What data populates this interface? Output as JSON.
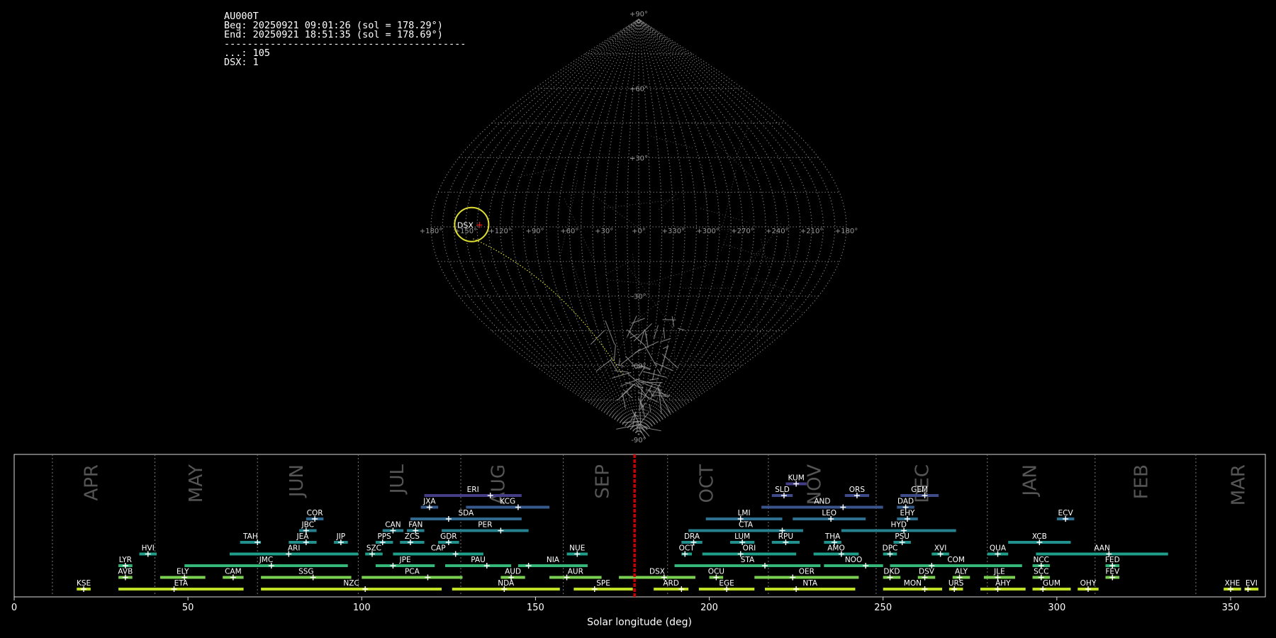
{
  "info": {
    "station": "AU000T",
    "begin": "Beg: 20250921 09:01:26 (sol = 178.29°)",
    "end": "End: 20250921 18:51:35 (sol = 178.69°)",
    "separator": "------------------------------------------",
    "count_unassoc": "...: 105",
    "count_dsx": "DSX: 1"
  },
  "colors": {
    "background": "#000000",
    "grid": "#7f7f7f",
    "radiant_outline": "#dddd33",
    "radiant_marker": "#ff2020",
    "current_sol_line": "#cc0000",
    "month_label": "#555555"
  },
  "chart_data": [
    {
      "type": "scatter",
      "projection": "sinusoidal",
      "grid_dotted": true,
      "lat_ticks": [
        "+90°",
        "+60°",
        "+30°",
        "-30°",
        "-60°",
        "-90°"
      ],
      "lon_ticks": [
        "+180°",
        "+150°",
        "+120°",
        "+90°",
        "+60°",
        "+30°",
        "+0°",
        "+330°",
        "+300°",
        "+270°",
        "+240°",
        "+210°",
        "+180°"
      ],
      "radiants": [
        {
          "label": "DSX",
          "lambda_rel": 146,
          "beta": 1,
          "color": "#dddd33"
        }
      ],
      "dsx_track_end": {
        "lambda_rel": 32,
        "beta": -64
      }
    },
    {
      "type": "timeline",
      "xlabel": "Solar longitude (deg)",
      "xlim": [
        0,
        360
      ],
      "xticks": [
        0,
        50,
        100,
        150,
        200,
        250,
        300,
        350
      ],
      "current_sol": 178.5,
      "months": [
        {
          "name": "APR",
          "start": 11,
          "center": 24
        },
        {
          "name": "MAY",
          "start": 40.5,
          "center": 54
        },
        {
          "name": "JUN",
          "start": 70,
          "center": 83
        },
        {
          "name": "JUL",
          "start": 99,
          "center": 112
        },
        {
          "name": "AUG",
          "start": 128.5,
          "center": 141
        },
        {
          "name": "SEP",
          "start": 158,
          "center": 171
        },
        {
          "name": "OCT",
          "start": 188,
          "center": 201
        },
        {
          "name": "NOV",
          "start": 217,
          "center": 232
        },
        {
          "name": "DEC",
          "start": 248,
          "center": 263
        },
        {
          "name": "JAN",
          "start": 280,
          "center": 294
        },
        {
          "name": "FEB",
          "start": 311,
          "center": 326
        },
        {
          "name": "MAR",
          "start": 340,
          "center": 354
        }
      ],
      "showers": [
        {
          "code": "KUM",
          "start": 222,
          "end": 228,
          "peak": 225,
          "row": 10,
          "color": "#433e85"
        },
        {
          "code": "ERI",
          "start": 118,
          "end": 146,
          "peak": 137,
          "row": 9,
          "color": "#433e85"
        },
        {
          "code": "SLD",
          "start": 218,
          "end": 224,
          "peak": 221.5,
          "row": 9,
          "color": "#3f4a8a"
        },
        {
          "code": "ORS",
          "start": 239,
          "end": 246,
          "peak": 242.5,
          "row": 9,
          "color": "#3f4a8a"
        },
        {
          "code": "GEM",
          "start": 255,
          "end": 266,
          "peak": 262,
          "row": 9,
          "color": "#3e4c8a"
        },
        {
          "code": "JXA",
          "start": 117,
          "end": 122,
          "peak": 119.5,
          "row": 8,
          "color": "#375a8c"
        },
        {
          "code": "KCG",
          "start": 130,
          "end": 154,
          "peak": 145,
          "row": 8,
          "color": "#375a8c"
        },
        {
          "code": "AND",
          "start": 215,
          "end": 250,
          "peak": 238.5,
          "row": 8,
          "color": "#3a548c"
        },
        {
          "code": "DAD",
          "start": 254,
          "end": 259,
          "peak": 256.5,
          "row": 8,
          "color": "#375a8c"
        },
        {
          "code": "COR",
          "start": 84,
          "end": 89,
          "peak": 86.5,
          "row": 7,
          "color": "#31688e"
        },
        {
          "code": "SDA",
          "start": 114,
          "end": 146,
          "peak": 125,
          "row": 7,
          "color": "#31688e"
        },
        {
          "code": "LMI",
          "start": 199,
          "end": 221,
          "peak": 209,
          "row": 7,
          "color": "#2e6e8e"
        },
        {
          "code": "LEO",
          "start": 224,
          "end": 245,
          "peak": 235,
          "row": 7,
          "color": "#2e6e8e"
        },
        {
          "code": "EHY",
          "start": 254,
          "end": 260,
          "peak": 257,
          "row": 7,
          "color": "#2e6e8e"
        },
        {
          "code": "ECV",
          "start": 300,
          "end": 305,
          "peak": 302.5,
          "row": 7,
          "color": "#2e6e8e"
        },
        {
          "code": "JBC",
          "start": 82,
          "end": 87,
          "peak": 84,
          "row": 6,
          "color": "#26828e"
        },
        {
          "code": "CAN",
          "start": 106,
          "end": 112,
          "peak": 109,
          "row": 6,
          "color": "#26828e"
        },
        {
          "code": "FAN",
          "start": 113,
          "end": 118,
          "peak": 115.5,
          "row": 6,
          "color": "#26828e"
        },
        {
          "code": "PER",
          "start": 123,
          "end": 148,
          "peak": 140,
          "row": 6,
          "color": "#26828e"
        },
        {
          "code": "CTA",
          "start": 194,
          "end": 227,
          "peak": 221,
          "row": 6,
          "color": "#26828e"
        },
        {
          "code": "HYD",
          "start": 238,
          "end": 271,
          "peak": 256,
          "row": 6,
          "color": "#26828e"
        },
        {
          "code": "TAH",
          "start": 65,
          "end": 71,
          "peak": 70,
          "row": 5,
          "color": "#22908c"
        },
        {
          "code": "JEA",
          "start": 79,
          "end": 87,
          "peak": 84,
          "row": 5,
          "color": "#22908c"
        },
        {
          "code": "JIP",
          "start": 92,
          "end": 96,
          "peak": 94,
          "row": 5,
          "color": "#22908c"
        },
        {
          "code": "PPS",
          "start": 104,
          "end": 109,
          "peak": 106,
          "row": 5,
          "color": "#22908c"
        },
        {
          "code": "ZCS",
          "start": 111,
          "end": 118,
          "peak": 114,
          "row": 5,
          "color": "#22908c"
        },
        {
          "code": "GDR",
          "start": 122,
          "end": 128,
          "peak": 125,
          "row": 5,
          "color": "#22908c"
        },
        {
          "code": "DRA",
          "start": 192,
          "end": 198,
          "peak": 195.5,
          "row": 5,
          "color": "#22908c"
        },
        {
          "code": "LUM",
          "start": 206,
          "end": 213,
          "peak": 209.5,
          "row": 5,
          "color": "#22908c"
        },
        {
          "code": "RPU",
          "start": 218,
          "end": 226,
          "peak": 222,
          "row": 5,
          "color": "#22908c"
        },
        {
          "code": "THA",
          "start": 233,
          "end": 238,
          "peak": 236,
          "row": 5,
          "color": "#22908c"
        },
        {
          "code": "PSU",
          "start": 253,
          "end": 258,
          "peak": 255.5,
          "row": 5,
          "color": "#22908c"
        },
        {
          "code": "XCB",
          "start": 286,
          "end": 304,
          "peak": 295,
          "row": 5,
          "color": "#22908c"
        },
        {
          "code": "HVI",
          "start": 36,
          "end": 41,
          "peak": 38.5,
          "row": 4,
          "color": "#1f9e89"
        },
        {
          "code": "ARI",
          "start": 62,
          "end": 99,
          "peak": 79,
          "row": 4,
          "color": "#1f9e89"
        },
        {
          "code": "SZC",
          "start": 101,
          "end": 106,
          "peak": 103,
          "row": 4,
          "color": "#1f9e89"
        },
        {
          "code": "CAP",
          "start": 109,
          "end": 135,
          "peak": 127,
          "row": 4,
          "color": "#1f9e89"
        },
        {
          "code": "NUE",
          "start": 159,
          "end": 165,
          "peak": 162,
          "row": 4,
          "color": "#1f9e89"
        },
        {
          "code": "OCT",
          "start": 192,
          "end": 195,
          "peak": 193,
          "row": 4,
          "color": "#1f9e89"
        },
        {
          "code": "ORI",
          "start": 198,
          "end": 225,
          "peak": 209,
          "row": 4,
          "color": "#1f9e89"
        },
        {
          "code": "AMO",
          "start": 230,
          "end": 243,
          "peak": 238,
          "row": 4,
          "color": "#1f9e89"
        },
        {
          "code": "DPC",
          "start": 250,
          "end": 254,
          "peak": 252,
          "row": 4,
          "color": "#1f9e89"
        },
        {
          "code": "XVI",
          "start": 264,
          "end": 269,
          "peak": 266.5,
          "row": 4,
          "color": "#1f9e89"
        },
        {
          "code": "QUA",
          "start": 280,
          "end": 286,
          "peak": 283,
          "row": 4,
          "color": "#1f9e89"
        },
        {
          "code": "AAN",
          "start": 294,
          "end": 332,
          "peak": 315,
          "row": 4,
          "color": "#1f9e89"
        },
        {
          "code": "LYR",
          "start": 30,
          "end": 34,
          "peak": 32,
          "row": 3,
          "color": "#35b779"
        },
        {
          "code": "JMC",
          "start": 49,
          "end": 96,
          "peak": 74,
          "row": 3,
          "color": "#35b779"
        },
        {
          "code": "JPE",
          "start": 104,
          "end": 121,
          "peak": 109,
          "row": 3,
          "color": "#35b779"
        },
        {
          "code": "PAU",
          "start": 124,
          "end": 143,
          "peak": 136,
          "row": 3,
          "color": "#35b779"
        },
        {
          "code": "NIA",
          "start": 145,
          "end": 165,
          "peak": 148,
          "row": 3,
          "color": "#35b779"
        },
        {
          "code": "STA",
          "start": 190,
          "end": 232,
          "peak": 216,
          "row": 3,
          "color": "#35b779"
        },
        {
          "code": "NOO",
          "start": 233,
          "end": 250,
          "peak": 245,
          "row": 3,
          "color": "#35b779"
        },
        {
          "code": "COM",
          "start": 252,
          "end": 290,
          "peak": 264,
          "row": 3,
          "color": "#35b779"
        },
        {
          "code": "NCC",
          "start": 293,
          "end": 298,
          "peak": 295.5,
          "row": 3,
          "color": "#35b779"
        },
        {
          "code": "FED",
          "start": 314,
          "end": 318,
          "peak": 316,
          "row": 3,
          "color": "#35b779"
        },
        {
          "code": "AVB",
          "start": 30,
          "end": 34,
          "peak": 32,
          "row": 2,
          "color": "#7ad151"
        },
        {
          "code": "ELY",
          "start": 42,
          "end": 55,
          "peak": 49,
          "row": 2,
          "color": "#7ad151"
        },
        {
          "code": "CAM",
          "start": 60,
          "end": 66,
          "peak": 63,
          "row": 2,
          "color": "#7ad151"
        },
        {
          "code": "SSG",
          "start": 71,
          "end": 97,
          "peak": 86,
          "row": 2,
          "color": "#7ad151"
        },
        {
          "code": "PCA",
          "start": 100,
          "end": 129,
          "peak": 119,
          "row": 2,
          "color": "#7ad151"
        },
        {
          "code": "AUD",
          "start": 140,
          "end": 147,
          "peak": 143,
          "row": 2,
          "color": "#7ad151"
        },
        {
          "code": "AUR",
          "start": 154,
          "end": 169,
          "peak": 159,
          "row": 2,
          "color": "#7ad151"
        },
        {
          "code": "DSX",
          "start": 174,
          "end": 196,
          "peak": 187,
          "row": 2,
          "color": "#7ad151"
        },
        {
          "code": "OCU",
          "start": 200,
          "end": 204,
          "peak": 202,
          "row": 2,
          "color": "#7ad151"
        },
        {
          "code": "OER",
          "start": 213,
          "end": 243,
          "peak": 224,
          "row": 2,
          "color": "#7ad151"
        },
        {
          "code": "DKD",
          "start": 250,
          "end": 255,
          "peak": 252,
          "row": 2,
          "color": "#7ad151"
        },
        {
          "code": "DSV",
          "start": 260,
          "end": 265,
          "peak": 262,
          "row": 2,
          "color": "#7ad151"
        },
        {
          "code": "ALY",
          "start": 270,
          "end": 275,
          "peak": 272,
          "row": 2,
          "color": "#7ad151"
        },
        {
          "code": "JLE",
          "start": 279,
          "end": 288,
          "peak": 283,
          "row": 2,
          "color": "#7ad151"
        },
        {
          "code": "SCC",
          "start": 293,
          "end": 298,
          "peak": 295.5,
          "row": 2,
          "color": "#7ad151"
        },
        {
          "code": "FEV",
          "start": 314,
          "end": 318,
          "peak": 316,
          "row": 2,
          "color": "#7ad151"
        },
        {
          "code": "KSE",
          "start": 18,
          "end": 22,
          "peak": 20,
          "row": 1,
          "color": "#bddf26"
        },
        {
          "code": "ETA",
          "start": 30,
          "end": 66,
          "peak": 46,
          "row": 1,
          "color": "#bddf26"
        },
        {
          "code": "NZC",
          "start": 71,
          "end": 123,
          "peak": 101,
          "row": 1,
          "color": "#bddf26"
        },
        {
          "code": "NDA",
          "start": 126,
          "end": 157,
          "peak": 141,
          "row": 1,
          "color": "#bddf26"
        },
        {
          "code": "SPE",
          "start": 161,
          "end": 178,
          "peak": 167,
          "row": 1,
          "color": "#bddf26"
        },
        {
          "code": "ARD",
          "start": 184,
          "end": 194,
          "peak": 192,
          "row": 1,
          "color": "#bddf26"
        },
        {
          "code": "EGE",
          "start": 197,
          "end": 213,
          "peak": 205,
          "row": 1,
          "color": "#bddf26"
        },
        {
          "code": "NTA",
          "start": 216,
          "end": 242,
          "peak": 225,
          "row": 1,
          "color": "#bddf26"
        },
        {
          "code": "MON",
          "start": 250,
          "end": 267,
          "peak": 262,
          "row": 1,
          "color": "#bddf26"
        },
        {
          "code": "URS",
          "start": 269,
          "end": 273,
          "peak": 270.5,
          "row": 1,
          "color": "#bddf26"
        },
        {
          "code": "AHY",
          "start": 278,
          "end": 291,
          "peak": 283,
          "row": 1,
          "color": "#bddf26"
        },
        {
          "code": "GUM",
          "start": 293,
          "end": 304,
          "peak": 296,
          "row": 1,
          "color": "#bddf26"
        },
        {
          "code": "OHY",
          "start": 306,
          "end": 312,
          "peak": 309,
          "row": 1,
          "color": "#bddf26"
        },
        {
          "code": "XHE",
          "start": 348,
          "end": 353,
          "peak": 350,
          "row": 1,
          "color": "#bddf26"
        },
        {
          "code": "EVI",
          "start": 354,
          "end": 358,
          "peak": 355,
          "row": 1,
          "color": "#bddf26"
        }
      ]
    }
  ]
}
